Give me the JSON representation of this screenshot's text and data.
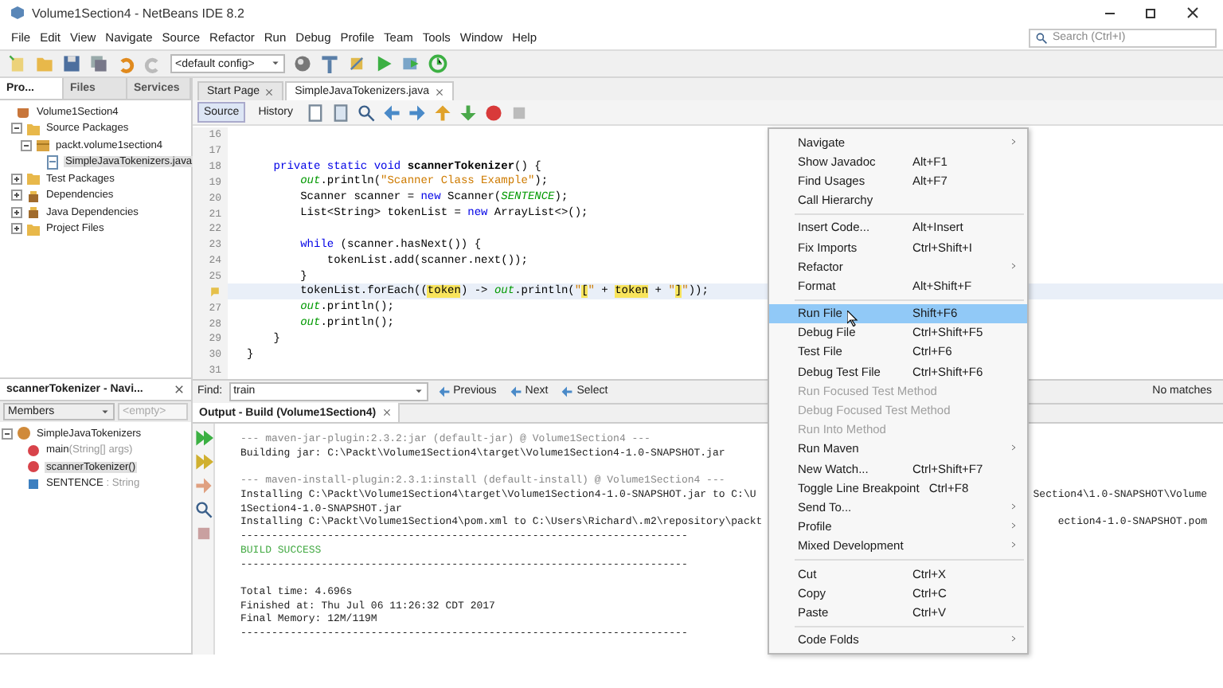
{
  "window": {
    "title": "Volume1Section4 - NetBeans IDE 8.2"
  },
  "menu_bar": [
    "File",
    "Edit",
    "View",
    "Navigate",
    "Source",
    "Refactor",
    "Run",
    "Debug",
    "Profile",
    "Team",
    "Tools",
    "Window",
    "Help"
  ],
  "search": {
    "placeholder": "Search (Ctrl+I)"
  },
  "toolbar": {
    "config": "<default config>"
  },
  "project_panel": {
    "tabs": [
      {
        "label": "Pro...",
        "selected": true
      },
      {
        "label": "Files",
        "selected": false
      },
      {
        "label": "Services",
        "selected": false
      }
    ],
    "tree": [
      {
        "label": "Volume1Section4",
        "kind": "project",
        "selected": false,
        "children": [
          {
            "label": "Source Packages",
            "kind": "folder",
            "expanded": true,
            "selected": false,
            "children": [
              {
                "label": "packt.volume1section4",
                "kind": "package",
                "expanded": true,
                "selected": false,
                "children": [
                  {
                    "label": "SimpleJavaTokenizers.java",
                    "kind": "file",
                    "selected": true
                  }
                ]
              }
            ]
          },
          {
            "label": "Test Packages",
            "kind": "folder",
            "expanded": false,
            "selected": false
          },
          {
            "label": "Dependencies",
            "kind": "jar",
            "expanded": false,
            "selected": false
          },
          {
            "label": "Java Dependencies",
            "kind": "jar",
            "expanded": false,
            "selected": false
          },
          {
            "label": "Project Files",
            "kind": "folder",
            "expanded": false,
            "selected": false
          }
        ]
      }
    ]
  },
  "navigator": {
    "title": "scannerTokenizer - Navi...",
    "filter": "Members",
    "field_placeholder": "<empty>",
    "tree": [
      {
        "label": "SimpleJavaTokenizers",
        "kind": "class",
        "expanded": true,
        "selected": false,
        "children": [
          {
            "label": "main",
            "detail": "(String[] args)",
            "kind": "method",
            "selected": false
          },
          {
            "label": "scannerTokenizer()",
            "kind": "method",
            "selected": true
          },
          {
            "label": "SENTENCE",
            "detail": " : String",
            "kind": "field",
            "selected": false
          }
        ]
      }
    ]
  },
  "editor": {
    "tabs": [
      {
        "label": "Start Page",
        "selected": false
      },
      {
        "label": "SimpleJavaTokenizers.java",
        "selected": true
      }
    ],
    "views": [
      {
        "label": "Source",
        "selected": true
      },
      {
        "label": "History",
        "selected": false
      }
    ],
    "lines": [
      {
        "number": "16",
        "current": false
      },
      {
        "number": "17",
        "current": false
      },
      {
        "number": "18",
        "current": false,
        "segments": [
          {
            "t": "    private static void ",
            "kind": "kw"
          },
          {
            "t": "scannerTokenizer",
            "kind": "decl"
          },
          {
            "t": "() {",
            "kind": "plain"
          }
        ]
      },
      {
        "number": "19",
        "current": false,
        "segments": [
          {
            "t": "        out",
            "kind": "field"
          },
          {
            "t": ".println(",
            "kind": "plain"
          },
          {
            "t": "\"Scanner Class Example\"",
            "kind": "str"
          },
          {
            "t": ");",
            "kind": "plain"
          }
        ]
      },
      {
        "number": "20",
        "current": false,
        "segments": [
          {
            "t": "        Scanner scanner = ",
            "kind": "plain"
          },
          {
            "t": "new",
            "kind": "kw"
          },
          {
            "t": " Scanner(",
            "kind": "plain"
          },
          {
            "t": "SENTENCE",
            "kind": "field"
          },
          {
            "t": ");",
            "kind": "plain"
          }
        ]
      },
      {
        "number": "21",
        "current": false,
        "segments": [
          {
            "t": "        List<String> tokenList = ",
            "kind": "plain"
          },
          {
            "t": "new",
            "kind": "kw"
          },
          {
            "t": " ArrayList<>();",
            "kind": "plain"
          }
        ]
      },
      {
        "number": "22",
        "current": false
      },
      {
        "number": "23",
        "current": false,
        "segments": [
          {
            "t": "        while",
            "kind": "kw"
          },
          {
            "t": " (scanner.hasNext()) {",
            "kind": "plain"
          }
        ]
      },
      {
        "number": "24",
        "current": false,
        "segments": [
          {
            "t": "            tokenList.add(scanner.next());",
            "kind": "plain"
          }
        ]
      },
      {
        "number": "25",
        "current": false,
        "segments": [
          {
            "t": "        }",
            "kind": "plain"
          }
        ]
      },
      {
        "warning": true,
        "current": true,
        "segments": [
          {
            "t": "        tokenList.forEach((",
            "kind": "plain"
          },
          {
            "t": "token",
            "kind": "mark"
          },
          {
            "t": ") -> ",
            "kind": "plain"
          },
          {
            "t": "out",
            "kind": "field"
          },
          {
            "t": ".println(",
            "kind": "plain"
          },
          {
            "t": "\"",
            "kind": "str"
          },
          {
            "t": "[",
            "kind": "mark"
          },
          {
            "t": "\"",
            "kind": "str"
          },
          {
            "t": " + ",
            "kind": "plain"
          },
          {
            "t": "token",
            "kind": "mark"
          },
          {
            "t": " + ",
            "kind": "plain"
          },
          {
            "t": "\"",
            "kind": "str"
          },
          {
            "t": "]",
            "kind": "mark"
          },
          {
            "t": "\"",
            "kind": "str"
          },
          {
            "t": "));",
            "kind": "plain"
          }
        ]
      },
      {
        "number": "27",
        "current": false,
        "segments": [
          {
            "t": "        out",
            "kind": "field"
          },
          {
            "t": ".println();",
            "kind": "plain"
          }
        ]
      },
      {
        "number": "28",
        "current": false,
        "segments": [
          {
            "t": "        out",
            "kind": "field"
          },
          {
            "t": ".println();",
            "kind": "plain"
          }
        ]
      },
      {
        "number": "29",
        "current": false,
        "segments": [
          {
            "t": "    }",
            "kind": "plain"
          }
        ]
      },
      {
        "number": "30",
        "current": false,
        "segments": [
          {
            "t": "}",
            "kind": "plain"
          }
        ]
      },
      {
        "number": "31",
        "current": false
      }
    ]
  },
  "find_bar": {
    "label": "Find:",
    "value": "train",
    "buttons": [
      "Previous",
      "Next",
      "Select"
    ],
    "status": "No matches"
  },
  "output": {
    "title": "Output - Build (Volume1Section4)",
    "lines": [
      {
        "kind": "gray",
        "text": "--- maven-jar-plugin:2.3.2:jar (default-jar) @ Volume1Section4 ---"
      },
      {
        "kind": "plain",
        "text": "Building jar: C:\\Packt\\Volume1Section4\\target\\Volume1Section4-1.0-SNAPSHOT.jar"
      },
      {
        "kind": "blank"
      },
      {
        "kind": "gray",
        "text": "--- maven-install-plugin:2.3.1:install (default-install) @ Volume1Section4 ---"
      },
      {
        "kind": "plain",
        "text": "Installing C:\\Packt\\Volume1Section4\\target\\Volume1Section4-1.0-SNAPSHOT.jar to C:\\U",
        "right": "Section4\\1.0-SNAPSHOT\\Volume"
      },
      {
        "kind": "plain",
        "text": "1Section4-1.0-SNAPSHOT.jar"
      },
      {
        "kind": "plain",
        "text": "Installing C:\\Packt\\Volume1Section4\\pom.xml to C:\\Users\\Richard\\.m2\\repository\\packt",
        "right": "ection4-1.0-SNAPSHOT.pom"
      },
      {
        "kind": "plain",
        "text": "------------------------------------------------------------------------"
      },
      {
        "kind": "success",
        "text": "BUILD SUCCESS"
      },
      {
        "kind": "plain",
        "text": "------------------------------------------------------------------------"
      },
      {
        "kind": "blank"
      },
      {
        "kind": "plain",
        "text": "Total time: 4.696s"
      },
      {
        "kind": "plain",
        "text": "Finished at: Thu Jul 06 11:26:32 CDT 2017"
      },
      {
        "kind": "plain",
        "text": "Final Memory: 12M/119M"
      },
      {
        "kind": "plain",
        "text": "------------------------------------------------------------------------"
      }
    ]
  },
  "context_menu": [
    {
      "kind": "item",
      "label": "Navigate",
      "submenu": true,
      "disabled": false,
      "selected": false
    },
    {
      "kind": "item",
      "label": "Show Javadoc",
      "shortcut": "Alt+F1",
      "disabled": false,
      "selected": false
    },
    {
      "kind": "item",
      "label": "Find Usages",
      "shortcut": "Alt+F7",
      "disabled": false,
      "selected": false
    },
    {
      "kind": "item",
      "label": "Call Hierarchy",
      "disabled": false,
      "selected": false
    },
    {
      "kind": "separator"
    },
    {
      "kind": "item",
      "label": "Insert Code...",
      "shortcut": "Alt+Insert",
      "disabled": false,
      "selected": false
    },
    {
      "kind": "item",
      "label": "Fix Imports",
      "shortcut": "Ctrl+Shift+I",
      "disabled": false,
      "selected": false
    },
    {
      "kind": "item",
      "label": "Refactor",
      "submenu": true,
      "disabled": false,
      "selected": false
    },
    {
      "kind": "item",
      "label": "Format",
      "shortcut": "Alt+Shift+F",
      "disabled": false,
      "selected": false
    },
    {
      "kind": "separator"
    },
    {
      "kind": "item",
      "label": "Run File",
      "shortcut": "Shift+F6",
      "disabled": false,
      "selected": true
    },
    {
      "kind": "item",
      "label": "Debug File",
      "shortcut": "Ctrl+Shift+F5",
      "disabled": false,
      "selected": false
    },
    {
      "kind": "item",
      "label": "Test File",
      "shortcut": "Ctrl+F6",
      "disabled": false,
      "selected": false
    },
    {
      "kind": "item",
      "label": "Debug Test File",
      "shortcut": "Ctrl+Shift+F6",
      "disabled": false,
      "selected": false
    },
    {
      "kind": "item",
      "label": "Run Focused Test Method",
      "disabled": true,
      "selected": false
    },
    {
      "kind": "item",
      "label": "Debug Focused Test Method",
      "disabled": true,
      "selected": false
    },
    {
      "kind": "item",
      "label": "Run Into Method",
      "disabled": true,
      "selected": false
    },
    {
      "kind": "item",
      "label": "Run Maven",
      "submenu": true,
      "disabled": false,
      "selected": false
    },
    {
      "kind": "item",
      "label": "New Watch...",
      "shortcut": "Ctrl+Shift+F7",
      "disabled": false,
      "selected": false
    },
    {
      "kind": "item",
      "label": "Toggle Line Breakpoint",
      "shortcut": "Ctrl+F8",
      "disabled": false,
      "selected": false
    },
    {
      "kind": "item",
      "label": "Send To...",
      "submenu": true,
      "disabled": false,
      "selected": false
    },
    {
      "kind": "item",
      "label": "Profile",
      "submenu": true,
      "disabled": false,
      "selected": false
    },
    {
      "kind": "item",
      "label": "Mixed Development",
      "submenu": true,
      "disabled": false,
      "selected": false
    },
    {
      "kind": "separator"
    },
    {
      "kind": "item",
      "label": "Cut",
      "shortcut": "Ctrl+X",
      "disabled": false,
      "selected": false
    },
    {
      "kind": "item",
      "label": "Copy",
      "shortcut": "Ctrl+C",
      "disabled": false,
      "selected": false
    },
    {
      "kind": "item",
      "label": "Paste",
      "shortcut": "Ctrl+V",
      "disabled": false,
      "selected": false
    },
    {
      "kind": "separator"
    },
    {
      "kind": "item",
      "label": "Code Folds",
      "submenu": true,
      "disabled": false,
      "selected": false
    }
  ]
}
